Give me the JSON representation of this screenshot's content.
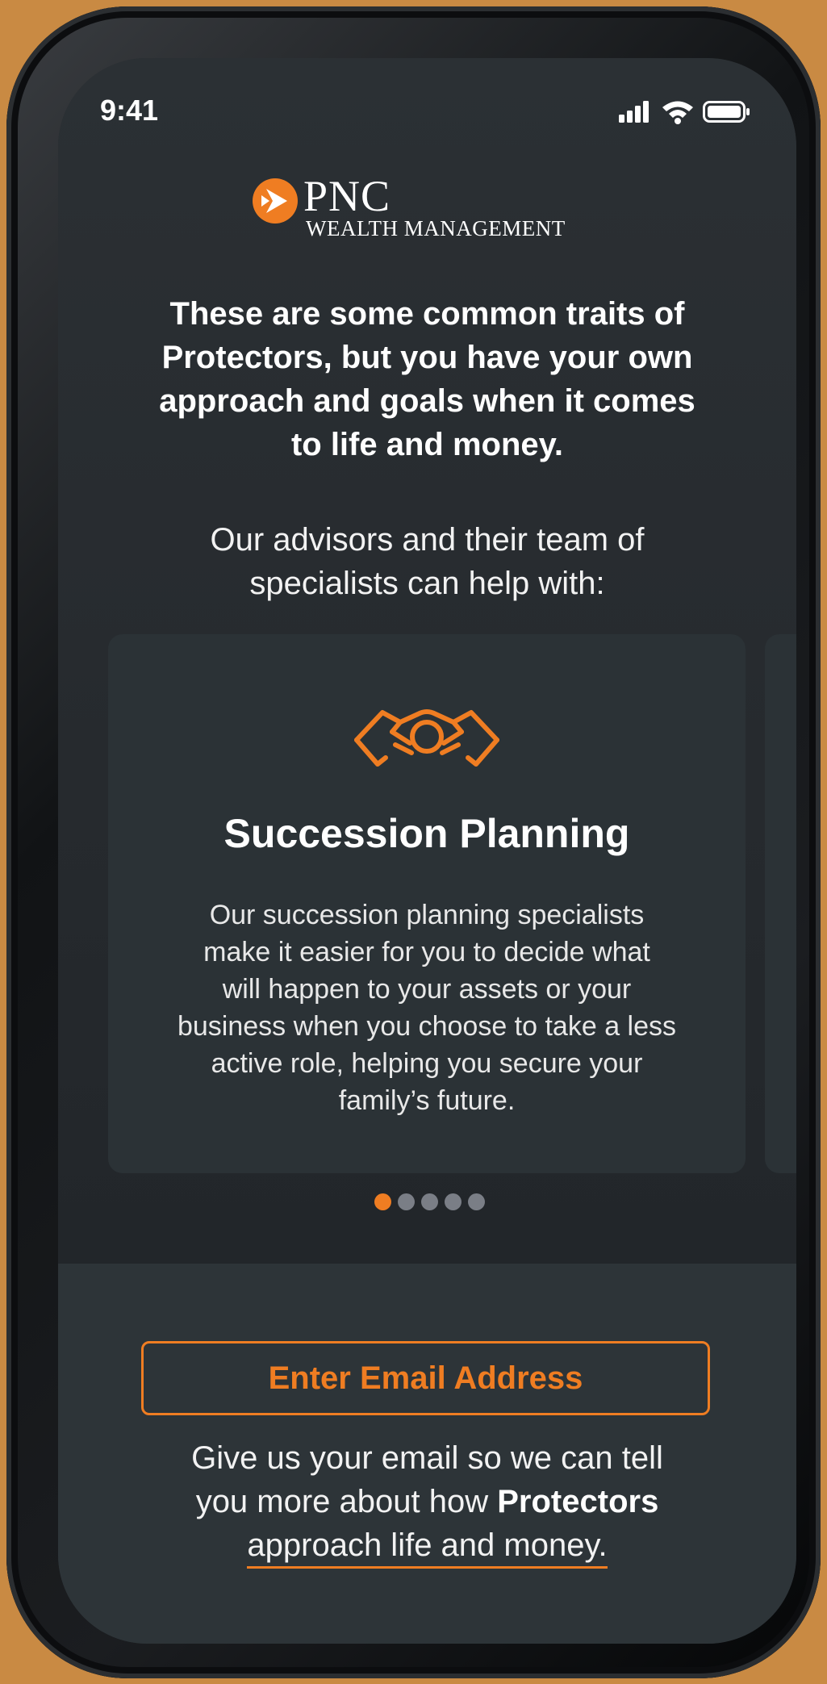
{
  "status_bar": {
    "time": "9:41"
  },
  "logo": {
    "brand": "PNC",
    "sub": "WEALTH MANAGEMENT"
  },
  "intro": {
    "headline_lines": [
      "These are some common traits of",
      "Protectors, but you have your own",
      "approach and goals when it comes",
      "to life and money."
    ],
    "subhead_lines": [
      "Our advisors and their team of",
      "specialists can help with:"
    ]
  },
  "carousel": {
    "active_index": 0,
    "dot_count": 5,
    "card": {
      "icon": "handshake-icon",
      "title": "Succession Planning",
      "body_lines": [
        "Our succession planning specialists",
        "make it easier for you to decide what",
        "will happen to your assets or your",
        "business when you choose to take a less",
        "active role, helping you secure your",
        "family’s future."
      ]
    }
  },
  "email_cta": {
    "button_label": "Enter Email Address"
  },
  "footer": {
    "line1": "Give us your email so we can tell",
    "line2_pre": "you more about how ",
    "line2_bold": "Protectors",
    "line3": "approach life and money."
  },
  "colors": {
    "accent": "#ef7d22",
    "background": "#c98a43",
    "screen": "#2b3034"
  }
}
